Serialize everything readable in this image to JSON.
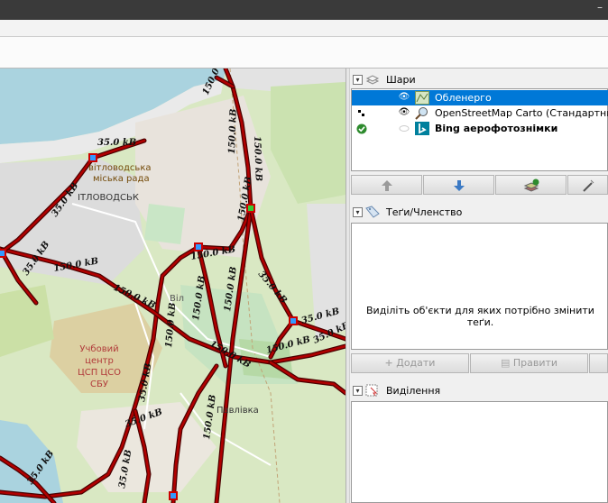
{
  "window": {
    "minimize": "–"
  },
  "map": {
    "labels": {
      "council": "вітловодська",
      "council2": "міська рада",
      "city": "ІТЛОВОДСЬК",
      "center1": "Учбовий",
      "center2": "центр",
      "center3": "ЦСП ЦСО",
      "center4": "СБУ",
      "village": "Павлівка",
      "vil": "Віл"
    },
    "line_labels": {
      "kv35": "35.0 kВ",
      "kv150": "150.0 kВ"
    }
  },
  "layers_panel": {
    "title": "Шари",
    "layers": [
      {
        "name": "Обленерго",
        "selected": true,
        "visible": true,
        "icon": "layer-data-icon"
      },
      {
        "name": "OpenStreetMap Carto (Стандартний)",
        "selected": false,
        "visible": true,
        "icon": "osm-imagery-icon"
      },
      {
        "name": "Bing аерофотознімки",
        "selected": false,
        "visible": false,
        "icon": "bing-icon"
      }
    ],
    "buttons": [
      "move-up",
      "move-down",
      "activate-layer",
      "layer-settings"
    ]
  },
  "tags_panel": {
    "title": "Теґи/Членство",
    "empty_message": "Виділіть об'єкти для яких потрібно змінити теґи.",
    "add_label": "Додати",
    "edit_label": "Правити"
  },
  "selection_panel": {
    "title": "Виділення"
  }
}
